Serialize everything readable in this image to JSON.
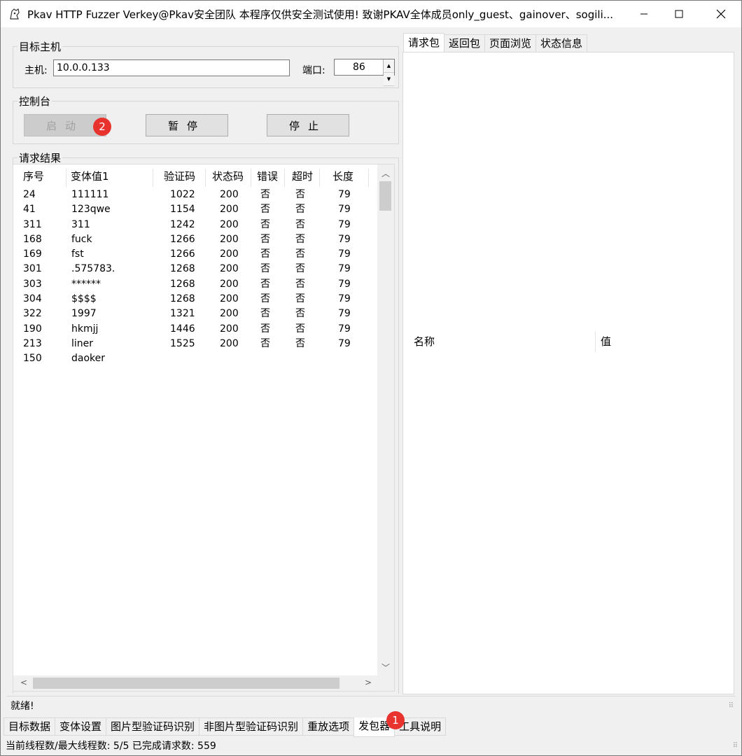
{
  "window": {
    "title": "Pkav HTTP Fuzzer   Verkey@Pkav安全团队  本程序仅供安全测试使用!  致谢PKAV全体成员only_guest、gainover、sogili..."
  },
  "target": {
    "group_label": "目标主机",
    "host_label": "主机:",
    "host_value": "10.0.0.133",
    "port_label": "端口:",
    "port_value": "86"
  },
  "console": {
    "group_label": "控制台",
    "start_label": "启动",
    "pause_label": "暂停",
    "stop_label": "停止",
    "start_badge": "2"
  },
  "results": {
    "group_label": "请求结果",
    "columns": [
      "序号",
      "变体值1",
      "验证码",
      "状态码",
      "错误",
      "超时",
      "长度"
    ],
    "rows": [
      {
        "id": "24",
        "value": "111111",
        "captcha": "1022",
        "status": "200",
        "error": "否",
        "timeout": "否",
        "length": "79"
      },
      {
        "id": "41",
        "value": "123qwe",
        "captcha": "1154",
        "status": "200",
        "error": "否",
        "timeout": "否",
        "length": "79"
      },
      {
        "id": "311",
        "value": "311",
        "captcha": "1242",
        "status": "200",
        "error": "否",
        "timeout": "否",
        "length": "79"
      },
      {
        "id": "168",
        "value": "fuck",
        "captcha": "1266",
        "status": "200",
        "error": "否",
        "timeout": "否",
        "length": "79"
      },
      {
        "id": "169",
        "value": "fst",
        "captcha": "1266",
        "status": "200",
        "error": "否",
        "timeout": "否",
        "length": "79"
      },
      {
        "id": "301",
        "value": ".575783.",
        "captcha": "1268",
        "status": "200",
        "error": "否",
        "timeout": "否",
        "length": "79"
      },
      {
        "id": "303",
        "value": "******",
        "captcha": "1268",
        "status": "200",
        "error": "否",
        "timeout": "否",
        "length": "79"
      },
      {
        "id": "304",
        "value": "$$$$",
        "captcha": "1268",
        "status": "200",
        "error": "否",
        "timeout": "否",
        "length": "79"
      },
      {
        "id": "322",
        "value": "1997",
        "captcha": "1321",
        "status": "200",
        "error": "否",
        "timeout": "否",
        "length": "79"
      },
      {
        "id": "190",
        "value": "hkmjj",
        "captcha": "1446",
        "status": "200",
        "error": "否",
        "timeout": "否",
        "length": "79"
      },
      {
        "id": "213",
        "value": "liner",
        "captcha": "1525",
        "status": "200",
        "error": "否",
        "timeout": "否",
        "length": "79"
      },
      {
        "id": "150",
        "value": "daoker",
        "captcha": "",
        "status": "",
        "error": "",
        "timeout": "",
        "length": ""
      }
    ]
  },
  "right_tabs": [
    "请求包",
    "返回包",
    "页面浏览",
    "状态信息"
  ],
  "right_panel": {
    "name_header": "名称",
    "value_header": "值"
  },
  "status_text": "就绪!",
  "bottom_tabs": [
    "目标数据",
    "变体设置",
    "图片型验证码识别",
    "非图片型验证码识别",
    "重放选项",
    "发包器",
    "工具说明"
  ],
  "bottom_tab_badge": "1",
  "footer_text": "当前线程数/最大线程数: 5/5  已完成请求数: 559",
  "colors": {
    "badge": "#e8322e",
    "window_bg": "#f0f0f0"
  }
}
